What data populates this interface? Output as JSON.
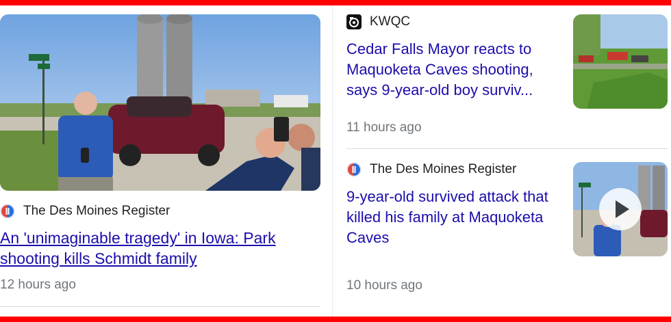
{
  "left_article": {
    "source": "The Des Moines Register",
    "headline": "An 'unimaginable tragedy' in Iowa: Park shooting kills Schmidt family",
    "time": "12 hours ago",
    "image_icon": "news-photo-reporter-silos"
  },
  "right_articles": [
    {
      "source": "KWQC",
      "source_icon": "kwqc-logo-icon",
      "headline": "Cedar Falls Mayor reacts to Maquoketa Caves shooting, says 9-year-old boy surviv...",
      "time": "11 hours ago",
      "has_video": false
    },
    {
      "source": "The Des Moines Register",
      "source_icon": "des-moines-register-icon",
      "headline": "9-year-old survived attack that killed his family at Maquoketa Caves",
      "time": "10 hours ago",
      "has_video": true
    }
  ],
  "colors": {
    "headline_link": "#1a0dab",
    "timestamp": "#70757a",
    "frame_red": "#ff0000",
    "divider": "#dadce0"
  }
}
